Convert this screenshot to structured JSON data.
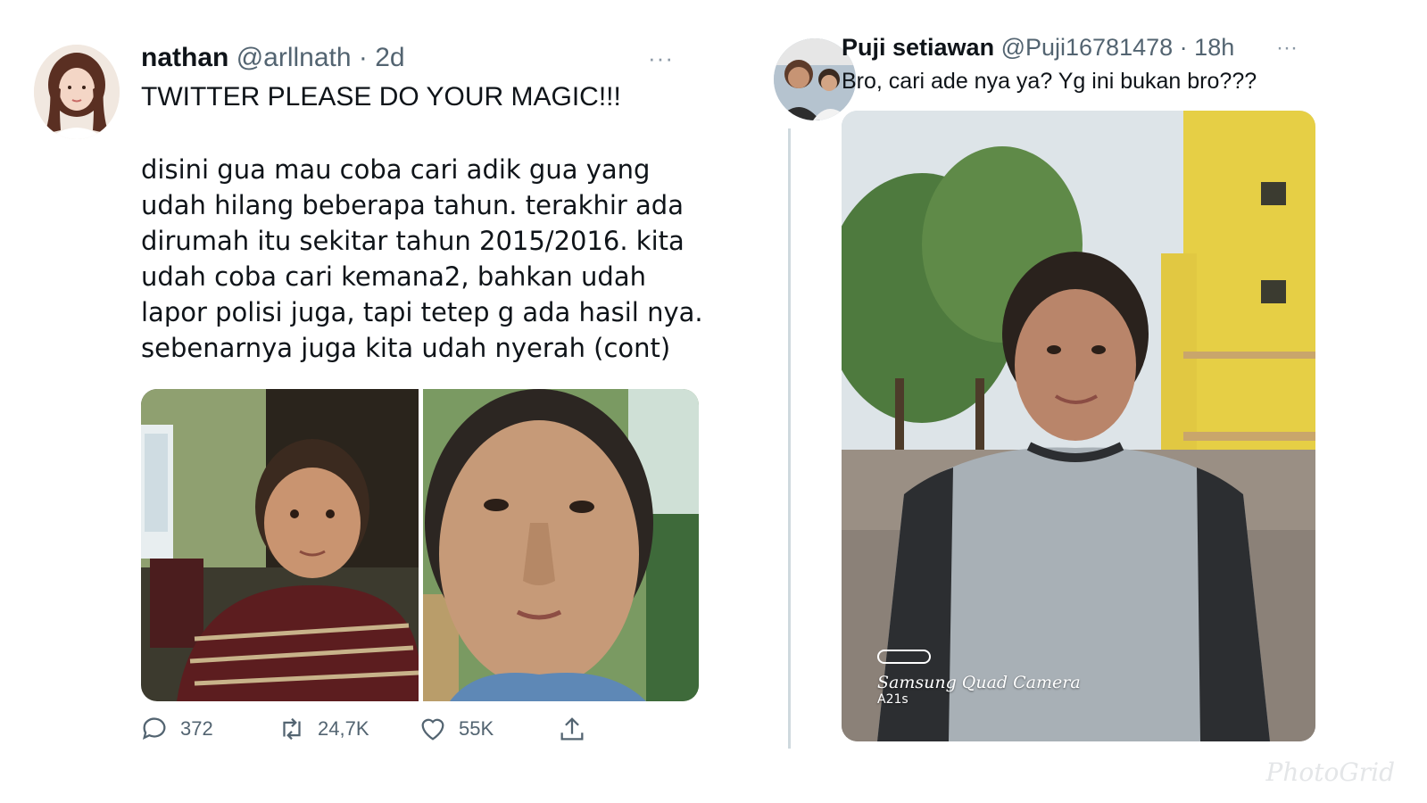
{
  "left_tweet": {
    "name": "nathan",
    "handle": "@arllnath",
    "separator": "·",
    "time": "2d",
    "more": "···",
    "title": "TWITTER PLEASE DO YOUR MAGIC!!!",
    "body": "disini gua mau coba cari adik gua yang\nudah hilang beberapa tahun. terakhir ada\ndirumah itu sekitar tahun 2015/2016. kita\nudah coba cari kemana2, bahkan udah\nlapor polisi juga, tapi tetep g ada hasil nya.\nsebenarnya juga kita udah nyerah (cont)",
    "actions": {
      "replies": "372",
      "retweets": "24,7K",
      "likes": "55K"
    }
  },
  "right_tweet": {
    "name": "Puji setiawan",
    "handle": "@Puji16781478",
    "separator": "·",
    "time": "18h",
    "more": "···",
    "text": "Bro, cari ade nya ya? Yg ini bukan bro???",
    "photo_watermark": {
      "line1": "Samsung Quad Camera",
      "line2": "A21s"
    }
  },
  "collage_watermark": "PhotoGrid",
  "colors": {
    "text": "#0f1419",
    "secondary": "#536471",
    "thread_line": "#cfd9de"
  }
}
